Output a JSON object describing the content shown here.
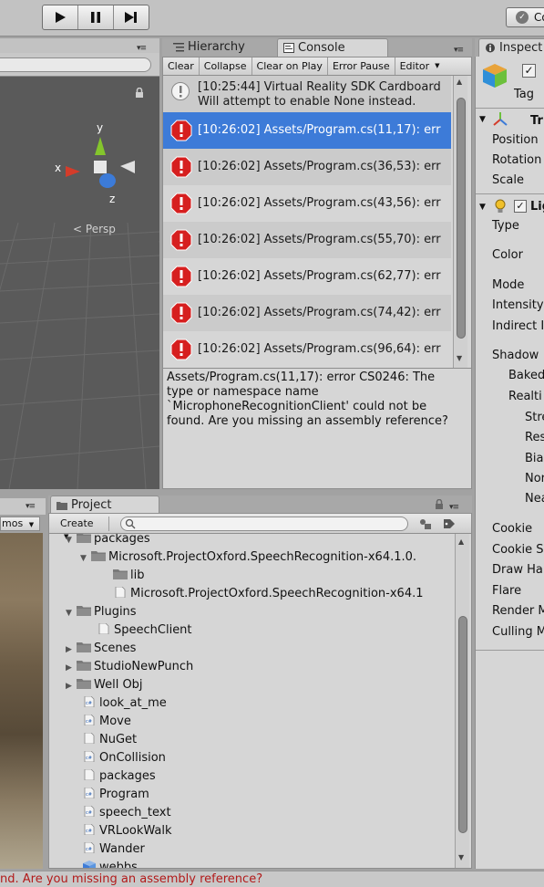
{
  "toolbar": {
    "play_icon": "play-icon",
    "pause_icon": "pause-icon",
    "step_icon": "step-icon",
    "collab_label": "Co"
  },
  "scene": {
    "gizmo_y": "y",
    "gizmo_x": "x",
    "gizmo_z": "z",
    "persp_label": "Persp"
  },
  "tabs": {
    "hierarchy": "Hierarchy",
    "console": "Console",
    "inspector": "Inspect",
    "project": "Project"
  },
  "console": {
    "buttons": [
      "Clear",
      "Collapse",
      "Clear on Play",
      "Error Pause",
      "Editor"
    ],
    "entries": [
      {
        "type": "warning",
        "line1": "[10:25:44] Virtual Reality SDK Cardboard",
        "line2": "Will attempt to enable None instead."
      },
      {
        "type": "error",
        "line1": "[10:26:02] Assets/Program.cs(11,17): err"
      },
      {
        "type": "error",
        "line1": "[10:26:02] Assets/Program.cs(36,53): err"
      },
      {
        "type": "error",
        "line1": "[10:26:02] Assets/Program.cs(43,56): err"
      },
      {
        "type": "error",
        "line1": "[10:26:02] Assets/Program.cs(55,70): err"
      },
      {
        "type": "error",
        "line1": "[10:26:02] Assets/Program.cs(62,77): err"
      },
      {
        "type": "error",
        "line1": "[10:26:02] Assets/Program.cs(74,42): err"
      },
      {
        "type": "error",
        "line1": "[10:26:02] Assets/Program.cs(96,64): err"
      }
    ],
    "detail_lines": [
      "Assets/Program.cs(11,17): error CS0246: The",
      "type or namespace name",
      "`MicrophoneRecognitionClient' could not be",
      "found. Are you missing an assembly reference?"
    ]
  },
  "game": {
    "gizmos_label": "mos"
  },
  "project": {
    "create_label": "Create",
    "items": [
      {
        "label": "packages",
        "depth": 1,
        "kind": "folder",
        "arrow": "down"
      },
      {
        "label": "Microsoft.ProjectOxford.SpeechRecognition-x64.1.0.",
        "depth": 2,
        "kind": "folder",
        "arrow": "down"
      },
      {
        "label": "lib",
        "depth": 3,
        "kind": "folder",
        "arrow": ""
      },
      {
        "label": "Microsoft.ProjectOxford.SpeechRecognition-x64.1",
        "depth": 3,
        "kind": "file",
        "arrow": ""
      },
      {
        "label": "Plugins",
        "depth": 1,
        "kind": "folder",
        "arrow": "down"
      },
      {
        "label": "SpeechClient",
        "depth": 2,
        "kind": "file",
        "arrow": ""
      },
      {
        "label": "Scenes",
        "depth": 1,
        "kind": "folder",
        "arrow": "right"
      },
      {
        "label": "StudioNewPunch",
        "depth": 1,
        "kind": "folder",
        "arrow": "right"
      },
      {
        "label": "Well Obj",
        "depth": 1,
        "kind": "folder",
        "arrow": "right"
      },
      {
        "label": "look_at_me",
        "depth": 1,
        "kind": "script",
        "arrow": ""
      },
      {
        "label": "Move",
        "depth": 1,
        "kind": "script",
        "arrow": ""
      },
      {
        "label": "NuGet",
        "depth": 1,
        "kind": "file",
        "arrow": ""
      },
      {
        "label": "OnCollision",
        "depth": 1,
        "kind": "script",
        "arrow": ""
      },
      {
        "label": "packages",
        "depth": 1,
        "kind": "file",
        "arrow": ""
      },
      {
        "label": "Program",
        "depth": 1,
        "kind": "script",
        "arrow": ""
      },
      {
        "label": "speech_text",
        "depth": 1,
        "kind": "script",
        "arrow": ""
      },
      {
        "label": "VRLookWalk",
        "depth": 1,
        "kind": "script",
        "arrow": ""
      },
      {
        "label": "Wander",
        "depth": 1,
        "kind": "script",
        "arrow": ""
      },
      {
        "label": "webbs",
        "depth": 1,
        "kind": "prefab",
        "arrow": ""
      }
    ]
  },
  "inspector": {
    "tag_label": "Tag",
    "transform_label": "Tr",
    "position_label": "Position",
    "rotation_label": "Rotation",
    "scale_label": "Scale",
    "light_label": "Lig",
    "type_label": "Type",
    "color_label": "Color",
    "mode_label": "Mode",
    "intensity_label": "Intensity",
    "indirect_label": "Indirect I",
    "shadow_label": "Shadow",
    "baked_label": "Baked",
    "realtime_label": "Realti",
    "strength_label": "Stre",
    "resolution_label": "Res",
    "bias_label": "Bias",
    "normal_label": "Nor",
    "near_label": "Nea",
    "cookie_label": "Cookie",
    "cookie_size_label": "Cookie S",
    "draw_halo_label": "Draw Ha",
    "flare_label": "Flare",
    "render_label": "Render M",
    "culling_label": "Culling M"
  },
  "status": {
    "message": "nd. Are you missing an assembly reference?"
  }
}
